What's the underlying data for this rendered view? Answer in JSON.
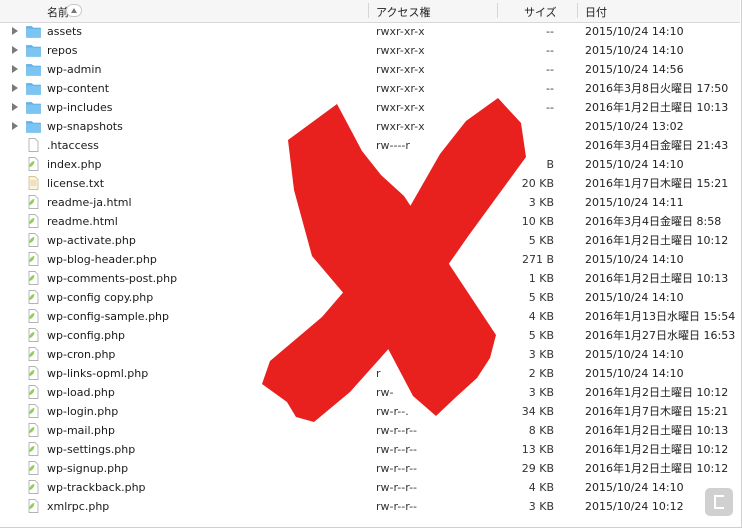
{
  "header": {
    "name": "名前",
    "access": "アクセス権",
    "size": "サイズ",
    "date": "日付"
  },
  "colors": {
    "folder": "#5eb5ee",
    "php": "#8fce5a",
    "x_mark": "#e8201e"
  },
  "files": [
    {
      "name": "assets",
      "perm": "rwxr-xr-x",
      "size": "--",
      "date": "2015/10/24 14:10",
      "type": "folder"
    },
    {
      "name": "repos",
      "perm": "rwxr-xr-x",
      "size": "--",
      "date": "2015/10/24 14:10",
      "type": "folder"
    },
    {
      "name": "wp-admin",
      "perm": "rwxr-xr-x",
      "size": "--",
      "date": "2015/10/24 14:56",
      "type": "folder"
    },
    {
      "name": "wp-content",
      "perm": "rwxr-xr-x",
      "size": "--",
      "date": "2016年3月8日火曜日 17:50",
      "type": "folder"
    },
    {
      "name": "wp-includes",
      "perm": "rwxr-xr-x",
      "size": "--",
      "date": "2016年1月2日土曜日 10:13",
      "type": "folder"
    },
    {
      "name": "wp-snapshots",
      "perm": "rwxr-xr-x",
      "size": "",
      "date": "2015/10/24 13:02",
      "type": "folder"
    },
    {
      "name": ".htaccess",
      "perm": "rw----r",
      "size": "",
      "date": "2016年3月4日金曜日 21:43",
      "type": "doc"
    },
    {
      "name": "index.php",
      "perm": "",
      "size": "B",
      "date": "2015/10/24 14:10",
      "type": "php"
    },
    {
      "name": "license.txt",
      "perm": "",
      "size": "20 KB",
      "date": "2016年1月7日木曜日 15:21",
      "type": "txt"
    },
    {
      "name": "readme-ja.html",
      "perm": "",
      "size": "3 KB",
      "date": "2015/10/24 14:11",
      "type": "php"
    },
    {
      "name": "readme.html",
      "perm": "",
      "size": "10 KB",
      "date": "2016年3月4日金曜日 8:58",
      "type": "php"
    },
    {
      "name": "wp-activate.php",
      "perm": "",
      "size": "5 KB",
      "date": "2016年1月2日土曜日 10:12",
      "type": "php"
    },
    {
      "name": "wp-blog-header.php",
      "perm": "",
      "size": "271 B",
      "date": "2015/10/24 14:10",
      "type": "php"
    },
    {
      "name": "wp-comments-post.php",
      "perm": "",
      "size": "1 KB",
      "date": "2016年1月2日土曜日 10:13",
      "type": "php"
    },
    {
      "name": "wp-config copy.php",
      "perm": "",
      "size": "5 KB",
      "date": "2015/10/24 14:10",
      "type": "php"
    },
    {
      "name": "wp-config-sample.php",
      "perm": "",
      "size": "4 KB",
      "date": "2016年1月13日水曜日 15:54",
      "type": "php"
    },
    {
      "name": "wp-config.php",
      "perm": "",
      "size": "5 KB",
      "date": "2016年1月27日水曜日 16:53",
      "type": "php"
    },
    {
      "name": "wp-cron.php",
      "perm": "",
      "size": "3 KB",
      "date": "2015/10/24 14:10",
      "type": "php"
    },
    {
      "name": "wp-links-opml.php",
      "perm": "r",
      "size": "2 KB",
      "date": "2015/10/24 14:10",
      "type": "php"
    },
    {
      "name": "wp-load.php",
      "perm": "rw-",
      "size": "3 KB",
      "date": "2016年1月2日土曜日 10:12",
      "type": "php"
    },
    {
      "name": "wp-login.php",
      "perm": "rw-r--.",
      "size": "34 KB",
      "date": "2016年1月7日木曜日 15:21",
      "type": "php"
    },
    {
      "name": "wp-mail.php",
      "perm": "rw-r--r--",
      "size": "8 KB",
      "date": "2016年1月2日土曜日 10:13",
      "type": "php"
    },
    {
      "name": "wp-settings.php",
      "perm": "rw-r--r--",
      "size": "13 KB",
      "date": "2016年1月2日土曜日 10:12",
      "type": "php"
    },
    {
      "name": "wp-signup.php",
      "perm": "rw-r--r--",
      "size": "29 KB",
      "date": "2016年1月2日土曜日 10:12",
      "type": "php"
    },
    {
      "name": "wp-trackback.php",
      "perm": "rw-r--r--",
      "size": "4 KB",
      "date": "2015/10/24 14:10",
      "type": "php"
    },
    {
      "name": "xmlrpc.php",
      "perm": "rw-r--r--",
      "size": "3 KB",
      "date": "2015/10/24 10:12",
      "type": "php"
    }
  ]
}
